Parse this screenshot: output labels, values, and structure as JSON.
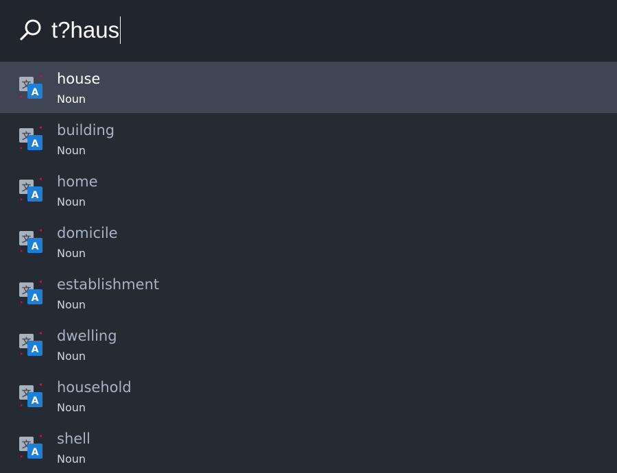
{
  "search": {
    "query": "t?haus"
  },
  "results": [
    {
      "title": "house",
      "subtitle": "Noun",
      "icon": "translate-icon"
    },
    {
      "title": "building",
      "subtitle": "Noun",
      "icon": "translate-icon"
    },
    {
      "title": "home",
      "subtitle": "Noun",
      "icon": "translate-icon"
    },
    {
      "title": "domicile",
      "subtitle": "Noun",
      "icon": "translate-icon"
    },
    {
      "title": "establishment",
      "subtitle": "Noun",
      "icon": "translate-icon"
    },
    {
      "title": "dwelling",
      "subtitle": "Noun",
      "icon": "translate-icon"
    },
    {
      "title": "household",
      "subtitle": "Noun",
      "icon": "translate-icon"
    },
    {
      "title": "shell",
      "subtitle": "Noun",
      "icon": "translate-icon"
    }
  ],
  "selected_index": 0,
  "colors": {
    "background": "#262a33",
    "search_background": "#21252c",
    "selected_row": "#3f4552",
    "title_text": "#a8b2c3",
    "icon_blue": "#1e7fd6",
    "icon_grey": "#a9b1bc",
    "icon_red": "#c0174a"
  }
}
